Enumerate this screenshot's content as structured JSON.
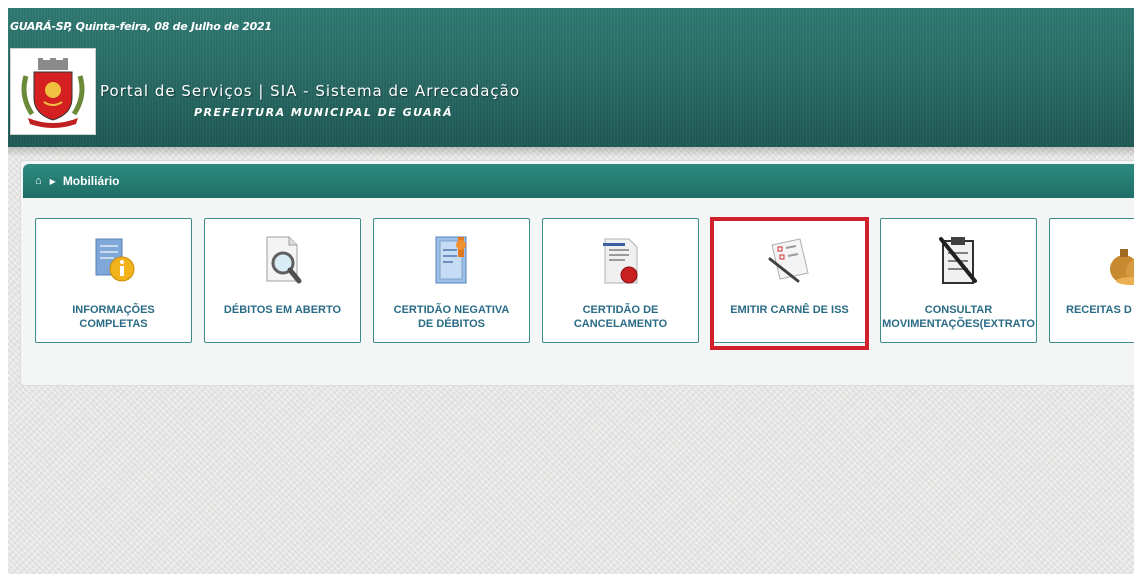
{
  "header": {
    "date_line": "GUARÁ-SP, Quinta-feira, 08 de Julho de 2021",
    "title": "Portal de Serviços | SIA - Sistema de Arrecadação",
    "subtitle": "PREFEITURA MUNICIPAL DE GUARÁ",
    "logo_icon": "municipal-coat-of-arms",
    "colors": {
      "header_teal": "#2b6e68",
      "bar_teal": "#1f6e66",
      "tile_text": "#2a6b86",
      "highlight_red": "#d0202b"
    }
  },
  "breadcrumb": {
    "home_icon": "home-icon",
    "current": "Mobiliário"
  },
  "tiles": [
    {
      "label": "INFORMAÇÕES\nCOMPLETAS",
      "icon": "info-document-icon"
    },
    {
      "label": "DÉBITOS EM ABERTO",
      "icon": "document-search-icon"
    },
    {
      "label": "CERTIDÃO NEGATIVA\nDE DÉBITOS",
      "icon": "certificate-icon"
    },
    {
      "label": "CERTIDÃO DE\nCANCELAMENTO",
      "icon": "seal-document-icon"
    },
    {
      "label": "EMITIR CARNÊ DE ISS",
      "icon": "document-pen-icon"
    },
    {
      "label": "CONSULTAR\nMOVIMENTAÇÕES(EXTRATO",
      "icon": "clipboard-pen-icon"
    },
    {
      "label": "RECEITAS D",
      "icon": "money-bags-icon"
    }
  ]
}
